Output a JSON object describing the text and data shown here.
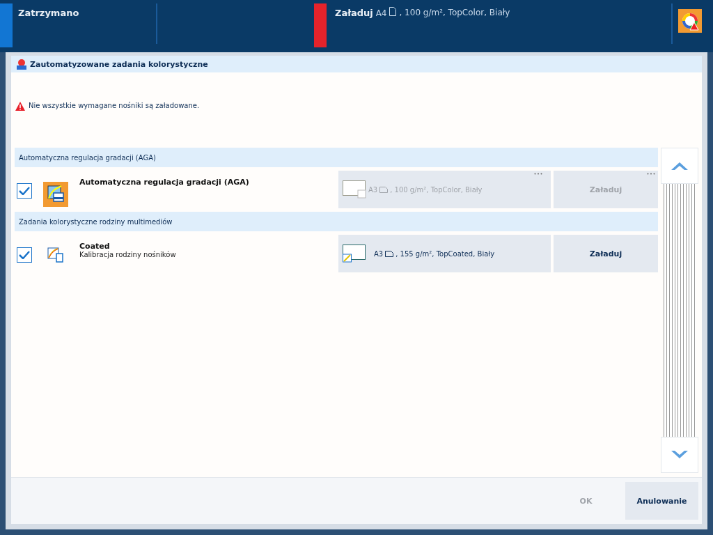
{
  "status_bar": {
    "state": "Zatrzymano",
    "load_label": "Załaduj",
    "load_size": "A4",
    "load_rest": ", 100 g/m², TopColor, Biały"
  },
  "dialog": {
    "title": "Zautomatyzowane zadania kolorystyczne",
    "warning": "Nie wszystkie wymagane nośniki są załadowane.",
    "groups": [
      {
        "header": "Automatyczna regulacja gradacji (AGA)",
        "tasks": [
          {
            "kind": "aga",
            "checked": true,
            "name": "Automatyczna regulacja gradacji (AGA)",
            "media_size": "A3",
            "media_rest": ", 100 g/m², TopColor, Biały",
            "disabled": true,
            "button": "Załaduj"
          }
        ]
      },
      {
        "header": "Zadania kolorystyczne rodziny multimediów",
        "tasks": [
          {
            "kind": "family",
            "checked": true,
            "name": "Coated",
            "subtitle": "Kalibracja rodziny nośników",
            "media_size": "A3",
            "media_rest": ", 155 g/m², TopCoated, Biały",
            "disabled": false,
            "button": "Załaduj"
          }
        ]
      }
    ]
  },
  "buttons": [
    {
      "label": "OK",
      "disabled": true
    },
    {
      "label": "Anulowanie",
      "disabled": false
    }
  ]
}
